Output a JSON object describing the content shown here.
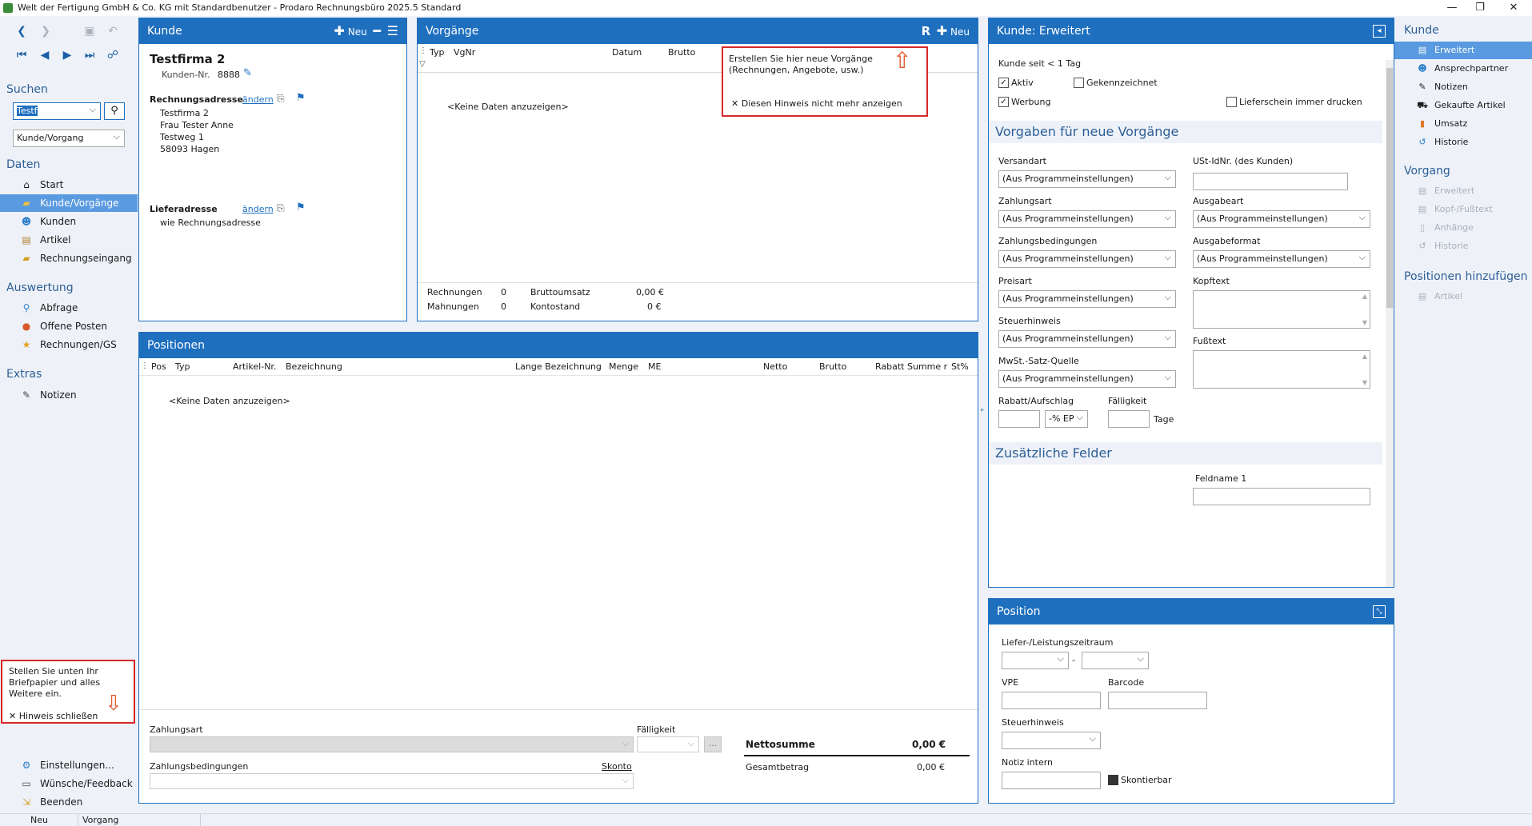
{
  "window": {
    "title": "Welt der Fertigung GmbH & Co. KG mit Standardbenutzer  -  Prodaro Rechnungsbüro 2025.5 Standard",
    "minimize": "—",
    "maximize": "❐",
    "close": "✕"
  },
  "leftnav": {
    "search_title": "Suchen",
    "search_value": "Testf",
    "search_scope": "Kunde/Vorgang",
    "daten_title": "Daten",
    "daten": [
      "Start",
      "Kunde/Vorgänge",
      "Kunden",
      "Artikel",
      "Rechnungseingang"
    ],
    "auswertung_title": "Auswertung",
    "auswertung": [
      "Abfrage",
      "Offene Posten",
      "Rechnungen/GS"
    ],
    "extras_title": "Extras",
    "extras": [
      "Notizen"
    ],
    "hint_text": "Stellen Sie unten Ihr Briefpapier und alles Weitere ein.",
    "hint_close": "Hinweis schließen",
    "bottom": [
      "Einstellungen...",
      "Wünsche/Feedback",
      "Beenden"
    ]
  },
  "kunde": {
    "title": "Kunde",
    "new": "Neu",
    "name": "Testfirma 2",
    "nr_label": "Kunden-Nr.",
    "nr": "8888",
    "rechnungsadresse_label": "Rechnungsadresse",
    "aendern": "ändern",
    "address": [
      "Testfirma 2",
      "Frau Tester Anne",
      "Testweg 1",
      "58093 Hagen"
    ],
    "lieferadresse_label": "Lieferadresse",
    "lieferadresse": "wie Rechnungsadresse"
  },
  "vorgaenge": {
    "title": "Vorgänge",
    "r": "R",
    "new": "Neu",
    "columns": [
      "Typ",
      "VgNr",
      "Datum",
      "Brutto"
    ],
    "empty": "<Keine Daten anzuzeigen>",
    "hint_text": "Erstellen Sie hier neue Vorgänge (Rechnungen, Angebote, usw.)",
    "hint_dismiss": "Diesen Hinweis nicht mehr anzeigen",
    "rechnungen_label": "Rechnungen",
    "rechnungen": "0",
    "mahnungen_label": "Mahnungen",
    "mahnungen": "0",
    "bruttoumsatz_label": "Bruttoumsatz",
    "bruttoumsatz": "0,00 €",
    "kontostand_label": "Kontostand",
    "kontostand": "0 €"
  },
  "positionen": {
    "title": "Positionen",
    "columns": [
      "Pos",
      "Typ",
      "Artikel-Nr.",
      "Bezeichnung",
      "Lange Bezeichnung",
      "Menge",
      "ME",
      "Netto",
      "Brutto",
      "Rabatt",
      "Summe r",
      "St%"
    ],
    "empty": "<Keine Daten anzuzeigen>",
    "zahlungsart_label": "Zahlungsart",
    "faelligkeit_label": "Fälligkeit",
    "zahlungsbedingungen_label": "Zahlungsbedingungen",
    "skonto": "Skonto",
    "ellipsis": "...",
    "nettosumme_label": "Nettosumme",
    "nettosumme": "0,00  €",
    "gesamtbetrag_label": "Gesamtbetrag",
    "gesamtbetrag": "0,00  €"
  },
  "erweitert": {
    "title": "Kunde: Erweitert",
    "kunde_seit": "Kunde seit < 1 Tag",
    "aktiv": "Aktiv",
    "gekennzeichnet": "Gekennzeichnet",
    "werbung": "Werbung",
    "lieferschein": "Lieferschein immer drucken",
    "vorgaben_title": "Vorgaben für neue Vorgänge",
    "default_value": "(Aus Programmeinstellungen)",
    "versandart": "Versandart",
    "ustid": "USt-IdNr. (des Kunden)",
    "zahlungsart": "Zahlungsart",
    "ausgabeart": "Ausgabeart",
    "zahlungsbedingungen": "Zahlungsbedingungen",
    "ausgabeformat": "Ausgabeformat",
    "preisart": "Preisart",
    "kopftext": "Kopftext",
    "steuerhinweis": "Steuerhinweis",
    "fusstext": "Fußtext",
    "mwst_quelle": "MwSt.-Satz-Quelle",
    "rabatt": "Rabatt/Aufschlag",
    "rabatt_unit": "-% EP",
    "faelligkeit": "Fälligkeit",
    "tage": "Tage",
    "zusatz_title": "Zusätzliche Felder",
    "feldname1": "Feldname 1"
  },
  "position": {
    "title": "Position",
    "liefer": "Liefer-/Leistungszeitraum",
    "dash": "-",
    "vpe": "VPE",
    "barcode": "Barcode",
    "steuerhinweis": "Steuerhinweis",
    "notiz": "Notiz intern",
    "skontierbar": "Skontierbar"
  },
  "rightnav": {
    "kunde_title": "Kunde",
    "kunde": [
      "Erweitert",
      "Ansprechpartner",
      "Notizen",
      "Gekaufte Artikel",
      "Umsatz",
      "Historie"
    ],
    "vorgang_title": "Vorgang",
    "vorgang": [
      "Erweitert",
      "Kopf-/Fußtext",
      "Anhänge",
      "Historie"
    ],
    "positionen_title": "Positionen hinzufügen",
    "positionen": [
      "Artikel"
    ]
  },
  "status": [
    "Neu",
    "Vorgang"
  ]
}
